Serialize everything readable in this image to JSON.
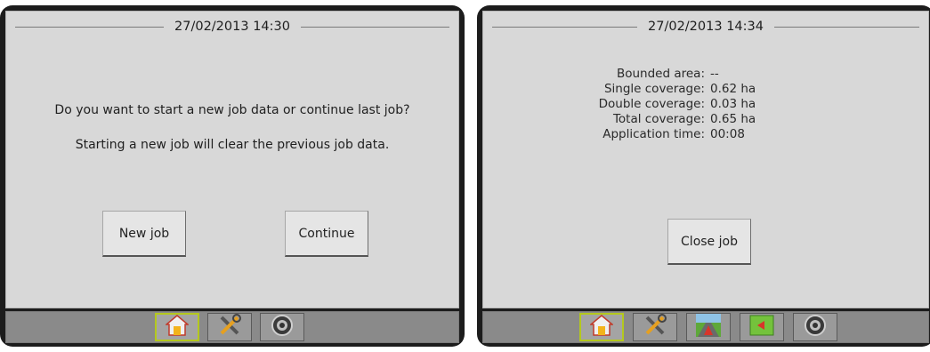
{
  "left_screen": {
    "datetime": "27/02/2013 14:30",
    "question": "Do you want to start a new job data or continue last job?",
    "warning": "Starting a new job will clear the previous job data.",
    "new_job_label": "New job",
    "continue_label": "Continue",
    "tabs": [
      {
        "icon": "home-icon",
        "active": true
      },
      {
        "icon": "tools-icon",
        "active": false
      },
      {
        "icon": "camera-icon",
        "active": false
      }
    ]
  },
  "right_screen": {
    "datetime": "27/02/2013 14:34",
    "stats": [
      {
        "label": "Bounded area:",
        "value": "--"
      },
      {
        "label": "Single coverage:",
        "value": "0.62 ha"
      },
      {
        "label": "Double coverage:",
        "value": "0.03 ha"
      },
      {
        "label": "Total coverage:",
        "value": "0.65 ha"
      },
      {
        "label": "Application time:",
        "value": "00:08"
      }
    ],
    "close_job_label": "Close job",
    "tabs": [
      {
        "icon": "home-icon",
        "active": true
      },
      {
        "icon": "tools-icon",
        "active": false
      },
      {
        "icon": "vehicle-view-icon",
        "active": false
      },
      {
        "icon": "field-view-icon",
        "active": false
      },
      {
        "icon": "camera-icon",
        "active": false
      }
    ]
  },
  "colors": {
    "bezel": "#1c1c1c",
    "panel": "#d8d8d8",
    "bottom_bar": "#8a8a8a",
    "active_tab_border": "#b4c81e"
  }
}
